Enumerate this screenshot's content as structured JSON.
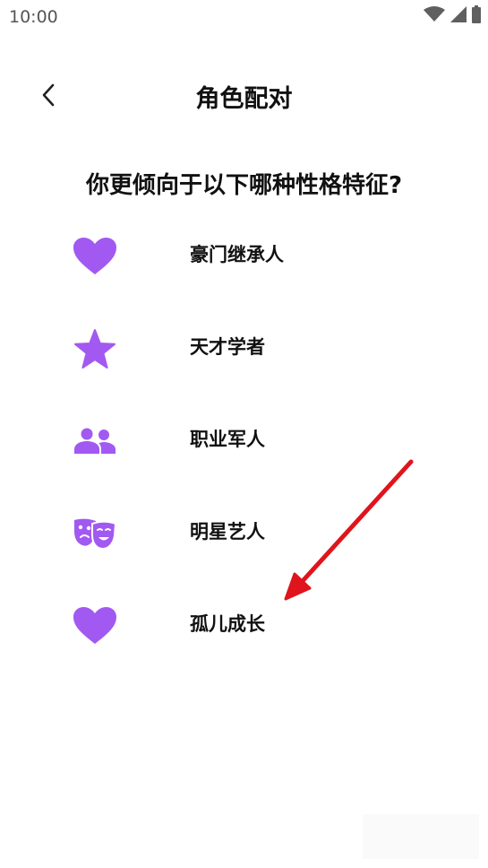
{
  "status_bar": {
    "time": "10:00",
    "icons": [
      "wifi-icon",
      "signal-icon",
      "battery-icon"
    ]
  },
  "header": {
    "title": "角色配对",
    "back_icon": "chevron-left-icon"
  },
  "question": "你更倾向于以下哪种性格特征?",
  "options": [
    {
      "label": "豪门继承人",
      "icon": "heart-icon"
    },
    {
      "label": "天才学者",
      "icon": "star-icon"
    },
    {
      "label": "职业军人",
      "icon": "people-icon"
    },
    {
      "label": "明星艺人",
      "icon": "theater-masks-icon"
    },
    {
      "label": "孤儿成长",
      "icon": "heart-icon"
    }
  ],
  "colors": {
    "accent": "#A259F1",
    "arrow": "#E0141C"
  }
}
